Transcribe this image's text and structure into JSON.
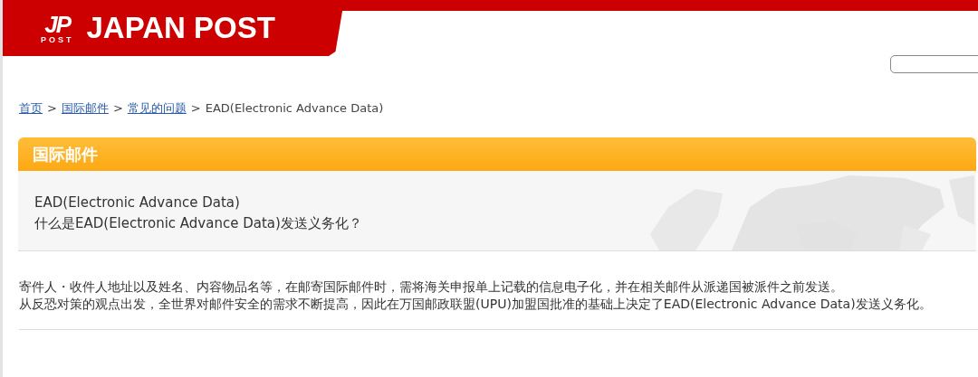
{
  "header": {
    "logo_mark": "JP",
    "logo_sub": "POST",
    "brand": "JAPAN POST"
  },
  "breadcrumb": [
    {
      "label": "首页",
      "link": true
    },
    {
      "label": "国际邮件",
      "link": true
    },
    {
      "label": "常见的问题",
      "link": true
    },
    {
      "label": "EAD(Electronic Advance Data)",
      "link": false
    }
  ],
  "breadcrumb_separator": ">",
  "section": {
    "title": "国际邮件"
  },
  "question": {
    "lines": [
      "EAD(Electronic Advance Data)",
      "什么是EAD(Electronic Advance Data)发送义务化？"
    ]
  },
  "answer": [
    "寄件人・收件人地址以及姓名、内容物品名等，在邮寄国际邮件时，需将海关申报单上记载的信息电子化，并在相关邮件从派递国被派件之前发送。",
    "从反恐对策的观点出发，全世界对邮件安全的需求不断提高，因此在万国邮政联盟(UPU)加盟国批准的基础上决定了EAD(Electronic Advance Data)发送义务化。"
  ]
}
